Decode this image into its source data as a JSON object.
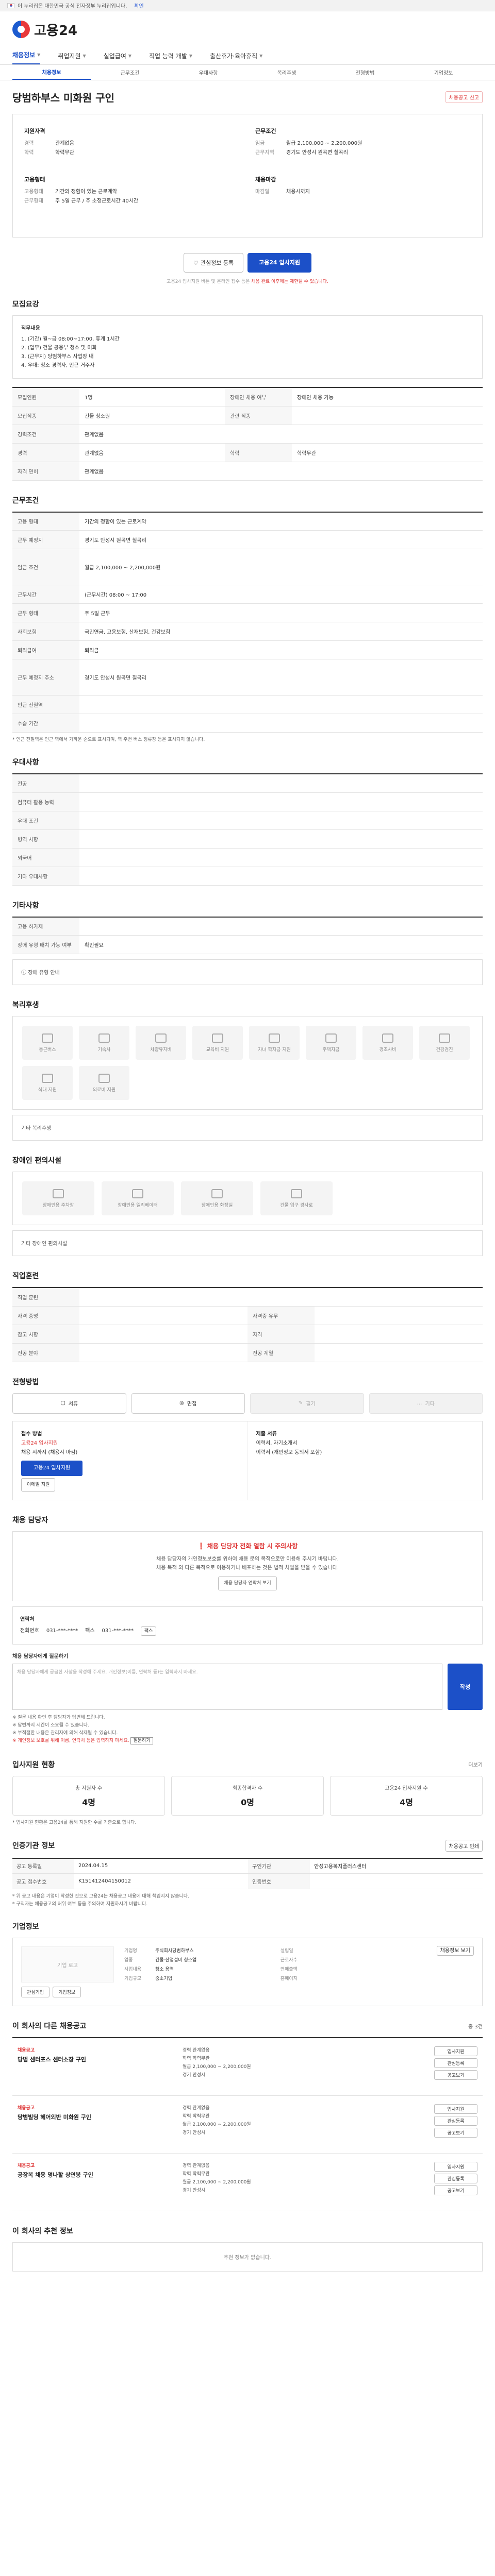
{
  "gov_banner": {
    "text": "이 누리집은 대한민국 공식 전자정부 누리집입니다.",
    "more": "확인"
  },
  "logo": {
    "text": "고용24"
  },
  "gnb": [
    {
      "label": "채용정보",
      "active": true
    },
    {
      "label": "취업지원",
      "active": false
    },
    {
      "label": "실업급여",
      "active": false
    },
    {
      "label": "직업 능력 개발",
      "active": false
    },
    {
      "label": "출산휴가·육아휴직",
      "active": false
    }
  ],
  "subnav": [
    "채용정보",
    "근무조건",
    "우대사항",
    "복리후생",
    "전형방법",
    "기업정보"
  ],
  "job": {
    "title": "당범하부스 미화원 구인",
    "report": "채용공고 신고"
  },
  "summary": {
    "left_title": "지원자격",
    "left_rows": [
      {
        "k": "경력",
        "v": "관계없음"
      },
      {
        "k": "학력",
        "v": "학력무관"
      }
    ],
    "left_title2": "고용형태",
    "left_rows2": [
      {
        "k": "고용형태",
        "v": "기간의 정함이 있는 근로계약"
      },
      {
        "k": "근무형태",
        "v": "주 5일 근무 / 주 소정근로시간 40시간"
      }
    ],
    "right_title": "근무조건",
    "right_rows": [
      {
        "k": "임금",
        "v": "월급 2,100,000 ~ 2,200,000원"
      },
      {
        "k": "근무지역",
        "v": "경기도 안성시 원곡면 칠곡리"
      }
    ],
    "right_title2": "채용마감",
    "right_rows2": [
      {
        "k": "마감일",
        "v": "채용시까지"
      }
    ]
  },
  "actions": {
    "interest": "관심정보 등록",
    "apply": "고용24 입사지원"
  },
  "notice": {
    "text": "고용24 입사지원 버튼 및 온라인 접수 등은",
    "red": "채용 완료 이후에는 제한될 수 있습니다."
  },
  "sections": {
    "job_detail": "모집요강",
    "conditions": "근무조건",
    "preferences": "우대사항",
    "etc": "기타사항",
    "welfare": "복리후생",
    "disability": "장애인 편의시설",
    "training": "직업훈련",
    "selection": "전형방법",
    "contact": "채용 담당자",
    "stats": "입사지원 현황",
    "recruit_info": "인증기관 정보",
    "company": "기업정보",
    "related": "이 회사의 다른 채용공고",
    "recommend": "이 회사의 추천 정보"
  },
  "job_detail": {
    "content_title": "직무내용",
    "lines": [
      "1. (기간) 월~금 08:00~17:00, 휴게 1시간",
      "2. (업무) 건물 공용부 청소 및 미화",
      "3. (근무지) 당범하부스 사업장 내",
      "4. 우대: 청소 경력자, 인근 거주자"
    ],
    "rows": [
      {
        "k": "모집인원",
        "v": "1명",
        "k2": "장애인 채용 여부",
        "v2": "장애인 채용 가능"
      },
      {
        "k": "모집직종",
        "v": "건물 청소원",
        "k2": "관련 직종",
        "v2": ""
      },
      {
        "k": "경력조건",
        "v": "관계없음",
        "k2": "",
        "v2": ""
      },
      {
        "k": "경력",
        "v": "관계없음",
        "k2": "학력",
        "v2": "학력무관"
      },
      {
        "k": "자격 면허",
        "v": "관계없음",
        "k2": "",
        "v2": ""
      }
    ]
  },
  "conditions": {
    "rows": [
      {
        "k": "고용 형태",
        "v": "기간의 정함이 있는 근로계약"
      },
      {
        "k": "근무 예정지",
        "v": "경기도 안성시 원곡면 칠곡리"
      },
      {
        "k": "임금 조건",
        "v": "월급 2,100,000 ~ 2,200,000원"
      },
      {
        "k": "근무시간",
        "v": "(근무시간) 08:00 ~ 17:00"
      },
      {
        "k": "근무 형태",
        "v": "주 5일 근무"
      },
      {
        "k": "사회보험",
        "v": "국민연금, 고용보험, 산재보험, 건강보험"
      },
      {
        "k": "퇴직급여",
        "v": "퇴직금"
      },
      {
        "k": "근무 예정지 주소",
        "v": "경기도 안성시 원곡면 칠곡리"
      },
      {
        "k": "인근 전철역",
        "v": ""
      },
      {
        "k": "수습 기간",
        "v": ""
      }
    ],
    "note": "* 인근 전철역은 인근 역에서 가까운 순으로 표시되며, 역 주변 버스 정류장 등은 표시되지 않습니다."
  },
  "preferences": {
    "rows": [
      {
        "k": "전공",
        "v": ""
      },
      {
        "k": "컴퓨터 활용 능력",
        "v": ""
      },
      {
        "k": "우대 조건",
        "v": ""
      },
      {
        "k": "병역 사항",
        "v": ""
      },
      {
        "k": "외국어",
        "v": ""
      },
      {
        "k": "기타 우대사항",
        "v": ""
      }
    ]
  },
  "etc": {
    "rows": [
      {
        "k": "고용 허가제",
        "v": ""
      },
      {
        "k": "장애 유형 배치 가능 여부",
        "v": "확인필요"
      }
    ],
    "note_link": "장애 유형 안내"
  },
  "welfare": {
    "items": [
      "통근버스",
      "기숙사",
      "차량유지비",
      "교육비 지원",
      "자녀 학자금 지원",
      "주택자금",
      "경조사비",
      "건강검진",
      "식대 지원",
      "의료비 지원"
    ],
    "etc_title": "기타 복리후생"
  },
  "disability": {
    "items": [
      "장애인용 주차장",
      "장애인용 엘리베이터",
      "장애인용 화장실",
      "건물 입구 경사로"
    ],
    "etc_title": "기타 장애인 편의시설"
  },
  "training": {
    "rows": [
      {
        "k": "직업 훈련",
        "v": "",
        "k2": "",
        "v2": ""
      },
      {
        "k": "자격 증명",
        "v": "",
        "k2": "자격증 유무",
        "v2": ""
      },
      {
        "k": "참고 사항",
        "v": "",
        "k2": "자격",
        "v2": ""
      },
      {
        "k": "전공 분야",
        "v": "",
        "k2": "전공 계열",
        "v2": ""
      }
    ]
  },
  "selection": {
    "steps": [
      {
        "label": "서류",
        "on": true
      },
      {
        "label": "면접",
        "on": true
      },
      {
        "label": "필기",
        "on": false
      },
      {
        "label": "기타",
        "on": false
      }
    ],
    "apply_left_t": "접수 방법",
    "apply_left_lines": [
      "고용24 입사지원",
      "채용 시까지 (채용시 마감)"
    ],
    "apply_btn": "고용24 입사지원",
    "apply_small": "이메일 지원",
    "apply_right_t": "제출 서류",
    "apply_right_lines": [
      "이력서, 자기소개서",
      "이력서 (개인정보 동의서 포함)"
    ]
  },
  "contact": {
    "warn_title": "채용 담당자 전화 열람 시 주의사항",
    "warn_lines": [
      "채용 담당자의 개인정보보호를 위하여 채용 문의 목적으로만 이용해 주시기 바랍니다.",
      "채용 목적 외 다른 목적으로 이용하거나 배포하는 것은 법적 처벌을 받을 수 있습니다."
    ],
    "warn_btn": "채용 담당자 연락처 보기",
    "box_title": "연락처",
    "tel_label": "전화번호",
    "tel": "031-***-****",
    "fax_label": "팩스",
    "fax": "031-***-****",
    "fax_btn": "팩스",
    "inquiry_title": "채용 담당자에게 질문하기",
    "inquiry_placeholder": "채용 담당자에게 궁금한 사항을 작성해 주세요. 개인정보(이름, 연락처 등)는 입력하지 마세요.",
    "inquiry_send": "작성",
    "tips": [
      "※ 질문 내용 확인 후 담당자가 답변해 드립니다.",
      "※ 답변까지 시간이 소요될 수 있습니다.",
      "※ 부적절한 내용은 관리자에 의해 삭제될 수 있습니다."
    ],
    "tips_red": "※ 개인정보 보호를 위해 이름, 연락처 등은 입력하지 마세요.",
    "tips_btn": "질문하기"
  },
  "stats": {
    "more": "더보기",
    "items": [
      {
        "label": "총 지원자 수",
        "n": "4명"
      },
      {
        "label": "최종합격자 수",
        "n": "0명"
      },
      {
        "label": "고용24 입사지원 수",
        "n": "4명"
      }
    ],
    "note": "* 입사지원 현황은 고용24를 통해 지원한 수를 기준으로 합니다."
  },
  "recruit_info": {
    "btn": "채용공고 인쇄",
    "rows": [
      {
        "k": "공고 등록일",
        "v": "2024.04.15",
        "k2": "구인기관",
        "v2": "안성고용복지플러스센터"
      },
      {
        "k": "공고 접수번호",
        "v": "K151412404150012",
        "k2": "인증번호",
        "v2": ""
      }
    ],
    "notes": [
      "* 위 공고 내용은 기업이 작성한 것으로 고용24는 채용공고 내용에 대해 책임지지 않습니다.",
      "* 구직자는 채용공고의 허위 여부 등을 주의하여 지원하시기 바랍니다."
    ]
  },
  "company": {
    "logo_alt": "기업 로고",
    "rows_left": [
      {
        "k": "기업명",
        "v": "주식회사당범하부스"
      },
      {
        "k": "업종",
        "v": "건물·산업설비 청소업"
      },
      {
        "k": "사업내용",
        "v": "청소 용역"
      },
      {
        "k": "기업규모",
        "v": "중소기업"
      }
    ],
    "rows_right": [
      {
        "k": "설립일",
        "v": ""
      },
      {
        "k": "근로자수",
        "v": ""
      },
      {
        "k": "연매출액",
        "v": ""
      },
      {
        "k": "홈페이지",
        "v": ""
      }
    ],
    "btns": [
      "관심기업",
      "기업정보"
    ],
    "right_btn": "채용정보 보기"
  },
  "related": {
    "header_note": "총 3건",
    "items": [
      {
        "co": "채용공고",
        "title": "당범 센터포스 센터소장 구인",
        "lines": [
          "경력 관계없음",
          "학력 학력무관",
          "월급 2,100,000 ~ 2,200,000원",
          "경기 안성시"
        ],
        "btns": [
          "입사지원",
          "관심등록",
          "공고보기"
        ]
      },
      {
        "co": "채용공고",
        "title": "당범빌딩 헤어외반 미화원 구인",
        "lines": [
          "경력 관계없음",
          "학력 학력무관",
          "월급 2,100,000 ~ 2,200,000원",
          "경기 안성시"
        ],
        "btns": [
          "입사지원",
          "관심등록",
          "공고보기"
        ]
      },
      {
        "co": "채용공고",
        "title": "공장복 채용 명나할 상연봉 구인",
        "lines": [
          "경력 관계없음",
          "학력 학력무관",
          "월급 2,100,000 ~ 2,200,000원",
          "경기 안성시"
        ],
        "btns": [
          "입사지원",
          "관심등록",
          "공고보기"
        ]
      }
    ]
  },
  "recommend": {
    "empty": "추천 정보가 없습니다."
  }
}
